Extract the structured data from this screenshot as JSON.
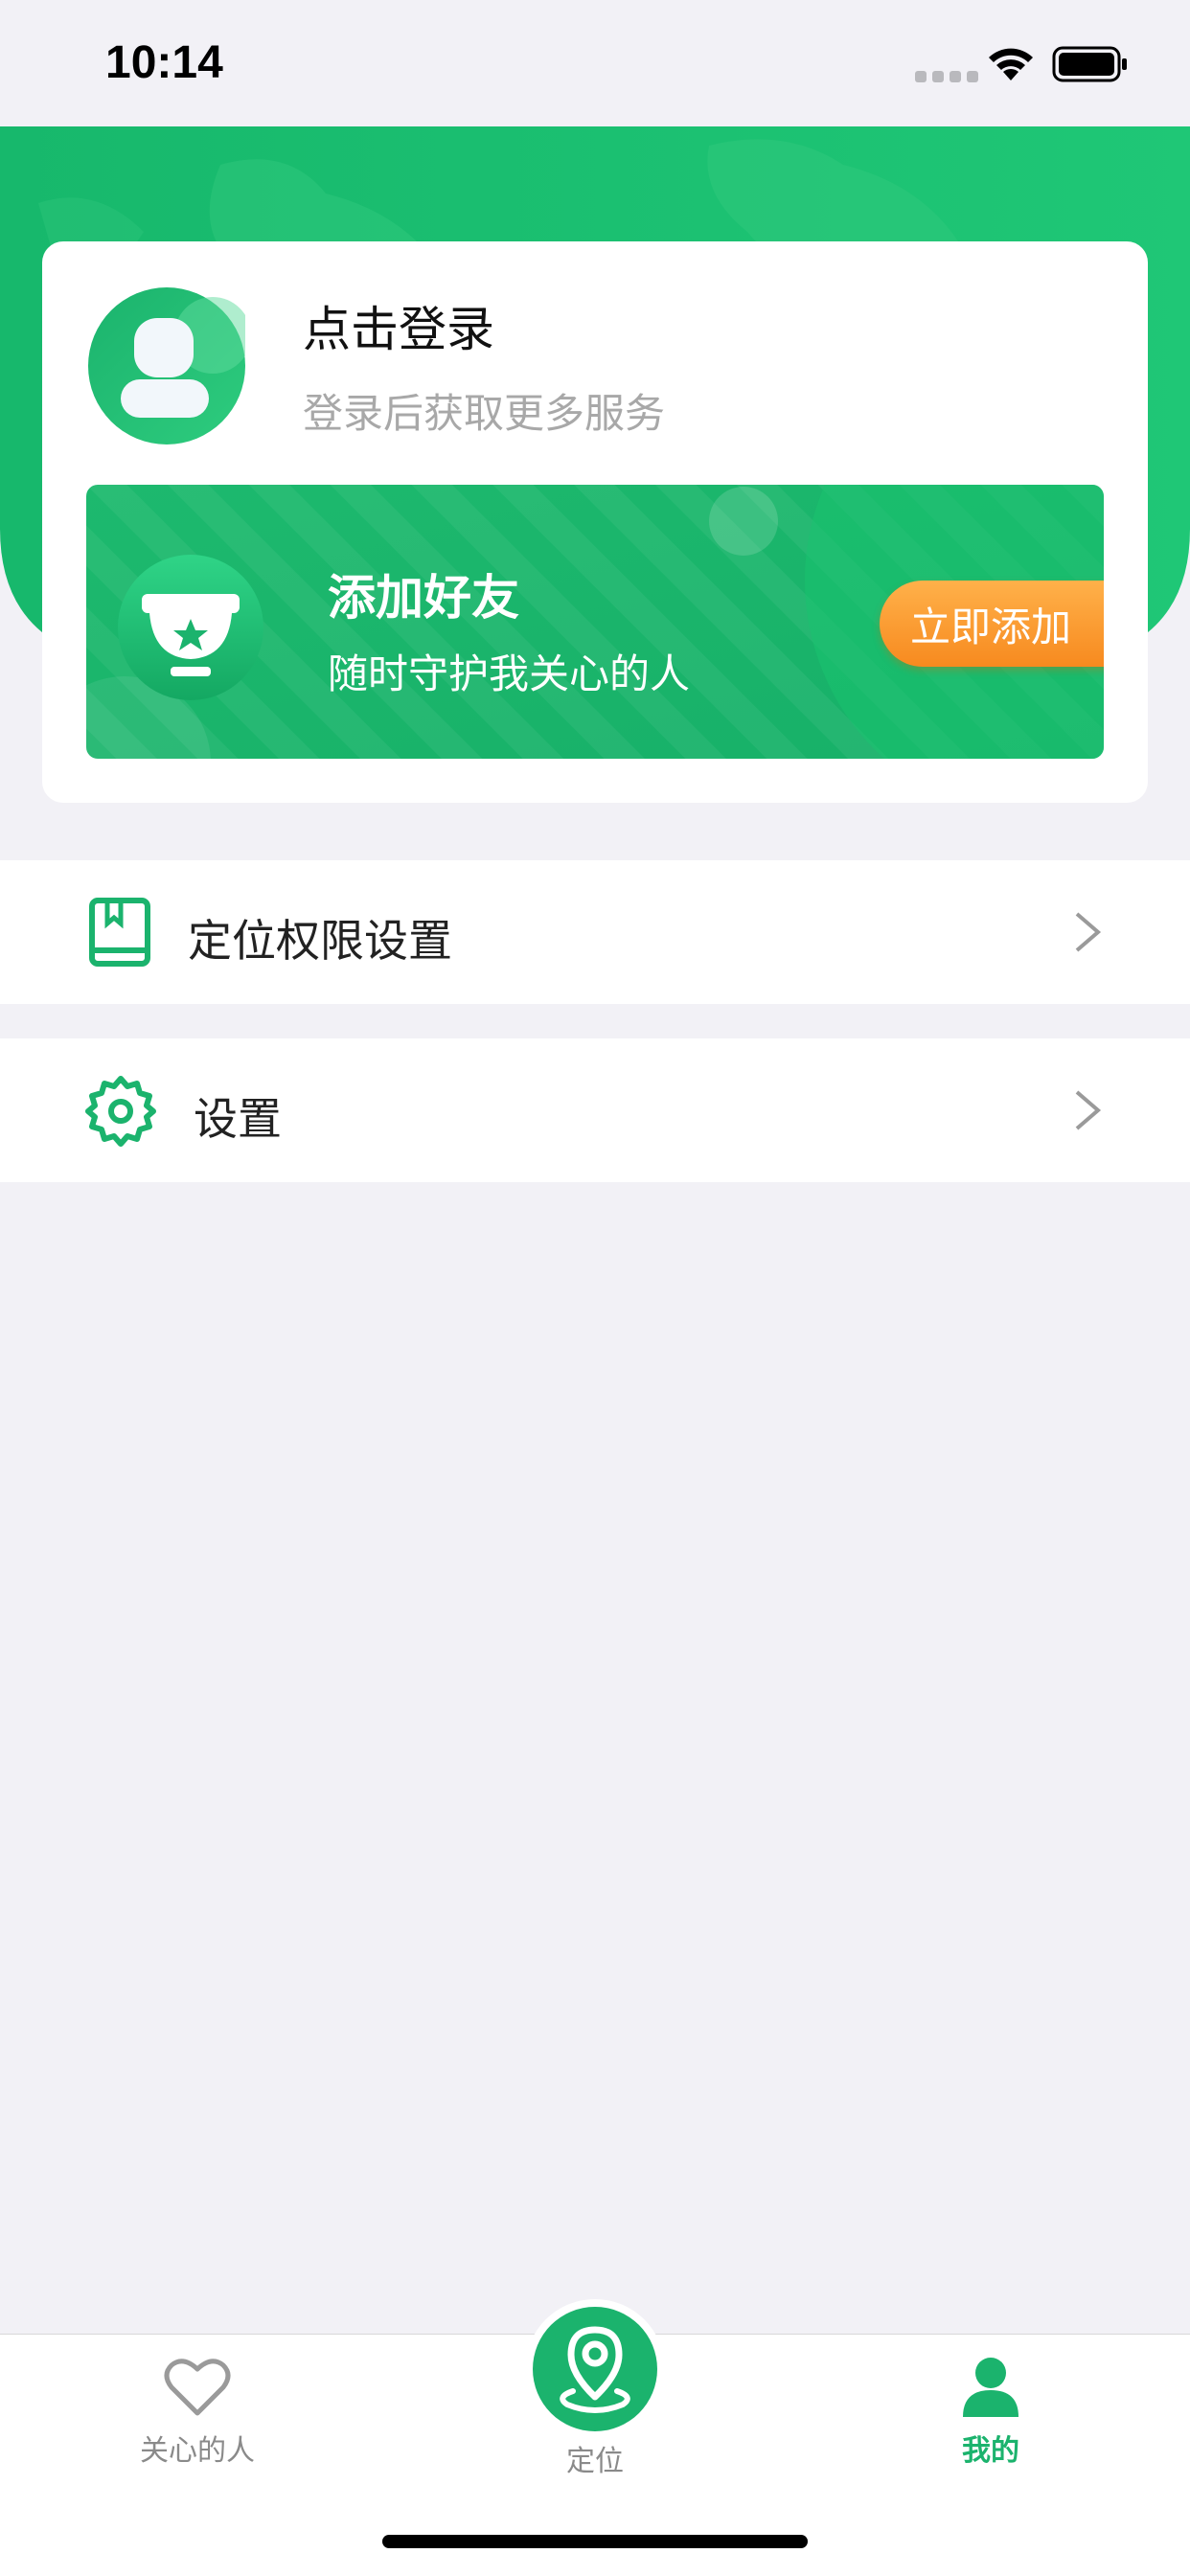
{
  "status_bar": {
    "time": "10:14"
  },
  "colors": {
    "brand_green": "#1bb36d",
    "orange": "#f78a1f",
    "background": "#f2f1f6"
  },
  "login_card": {
    "title": "点击登录",
    "subtitle": "登录后获取更多服务",
    "avatar_icon": "user-avatar-icon"
  },
  "banner": {
    "title": "添加好友",
    "subtitle": "随时守护我关心的人",
    "button_label": "立即添加",
    "icon": "trophy-star-icon"
  },
  "menu": [
    {
      "label": "定位权限设置",
      "icon": "book-icon"
    },
    {
      "label": "设置",
      "icon": "gear-icon"
    }
  ],
  "tabbar": {
    "tabs": [
      {
        "label": "关心的人",
        "icon": "heart-icon",
        "active": false
      },
      {
        "label": "定位",
        "icon": "location-pin-icon",
        "active": false
      },
      {
        "label": "我的",
        "icon": "person-icon",
        "active": true
      }
    ]
  }
}
